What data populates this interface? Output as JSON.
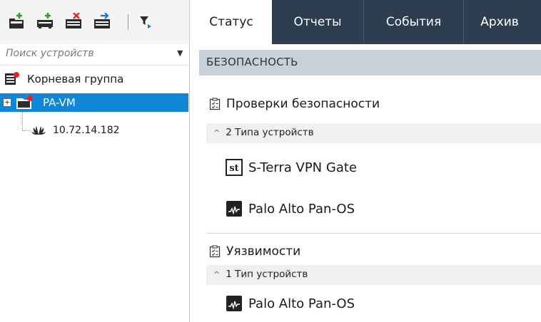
{
  "search": {
    "placeholder": "Поиск устройств"
  },
  "tree": {
    "root_label": "Корневая группа",
    "selected_label": "PA-VM",
    "device_ip": "10.72.14.182"
  },
  "tabs": [
    {
      "label": "Статус",
      "active": true
    },
    {
      "label": "Отчеты",
      "active": false
    },
    {
      "label": "События",
      "active": false
    },
    {
      "label": "Архив",
      "active": false
    }
  ],
  "section": {
    "title": "БЕЗОПАСНОСТЬ"
  },
  "checks": [
    {
      "title": "Проверки безопасности",
      "group_label": "2 Типа устройств",
      "devices": [
        "S-Terra VPN Gate",
        "Palo Alto Pan-OS"
      ]
    },
    {
      "title": "Уязвимости",
      "group_label": "1 Тип устройств",
      "devices": [
        "Palo Alto Pan-OS"
      ]
    }
  ],
  "colors": {
    "tab_bar": "#2d3e50",
    "selection": "#0f86d6",
    "section_header": "#c8d1da",
    "add_icon_green": "#2e9b2e",
    "delete_icon_red": "#e02424",
    "alert_red": "#e02424",
    "filter_blue": "#1e73d8"
  }
}
